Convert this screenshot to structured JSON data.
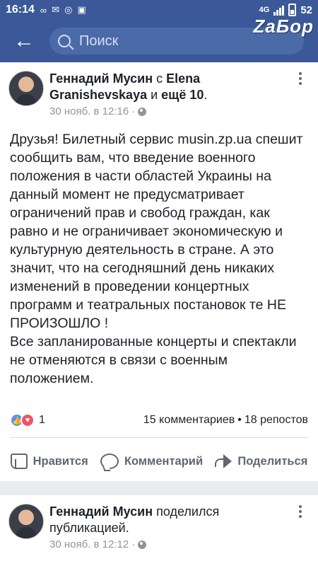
{
  "status_bar": {
    "time": "16:14",
    "battery": "52",
    "network": "4G"
  },
  "watermark": "ZaБор",
  "search": {
    "placeholder": "Поиск"
  },
  "posts": [
    {
      "author": "Геннадий Мусин",
      "connector": " с ",
      "tagged": "Elena Granishevskaya",
      "connector2": " и ",
      "others": "ещё 10",
      "suffix": ".",
      "date": "30 нояб. в 12:16",
      "privacy_icon": "globe-icon",
      "text": "Друзья! Билетный сервис musin.zp.ua спешит сообщить вам, что введение военного положения в части областей Украины на данный момент не предусматривает ограничений прав и свобод граждан, как равно и не ограничивает экономическую и культурную деятельность в стране. А это значит, что на сегодняшний день никаких изменений в проведении концертных программ и театральных постановок те НЕ ПРОИЗОШЛО !\nВсе запланированные концерты и спектакли не отменяются в связи с военным положением.",
      "reactions_count": "1",
      "comments": "15 комментариев",
      "separator": "•",
      "shares": "18 репостов",
      "actions": {
        "like": "Нравится",
        "comment": "Комментарий",
        "share": "Поделиться"
      }
    },
    {
      "author": "Геннадий Мусин",
      "action_text": " поделился публикацией.",
      "date": "30 нояб. в 12:12",
      "privacy_icon": "globe-icon"
    }
  ],
  "colors": {
    "brand": "#3b5998",
    "like_blue": "#5890ff",
    "love_red": "#f25268"
  }
}
